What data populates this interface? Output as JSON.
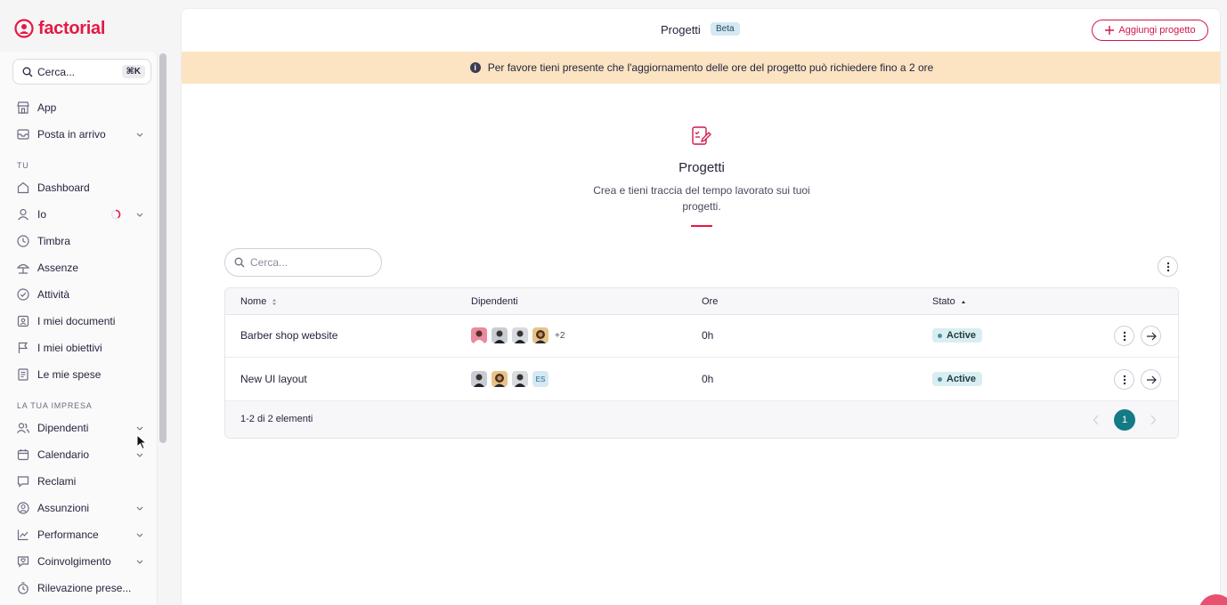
{
  "brand": {
    "name": "factorial",
    "color": "#e51943"
  },
  "sidebar": {
    "search": {
      "placeholder": "Cerca...",
      "shortcut": "⌘K"
    },
    "top_items": [
      {
        "label": "App",
        "icon": "shop-icon"
      },
      {
        "label": "Posta in arrivo",
        "icon": "inbox-icon",
        "has_chevron": true
      }
    ],
    "section_you": "TU",
    "you_items": [
      {
        "label": "Dashboard",
        "icon": "home-icon"
      },
      {
        "label": "Io",
        "icon": "person-icon",
        "has_chevron": true
      },
      {
        "label": "Timbra",
        "icon": "clock-icon"
      },
      {
        "label": "Assenze",
        "icon": "beach-icon"
      },
      {
        "label": "Attività",
        "icon": "check-circle-icon"
      },
      {
        "label": "I miei documenti",
        "icon": "folder-icon"
      },
      {
        "label": "I miei obiettivi",
        "icon": "flag-icon"
      },
      {
        "label": "Le mie spese",
        "icon": "receipt-icon"
      }
    ],
    "section_company": "LA TUA IMPRESA",
    "company_items": [
      {
        "label": "Dipendenti",
        "icon": "people-icon",
        "has_chevron": true
      },
      {
        "label": "Calendario",
        "icon": "calendar-icon",
        "has_chevron": true
      },
      {
        "label": "Reclami",
        "icon": "chat-icon"
      },
      {
        "label": "Assunzioni",
        "icon": "user-circle-icon",
        "has_chevron": true
      },
      {
        "label": "Performance",
        "icon": "chart-icon",
        "has_chevron": true
      },
      {
        "label": "Coinvolgimento",
        "icon": "heart-chat-icon",
        "has_chevron": true
      },
      {
        "label": "Rilevazione prese...",
        "icon": "stopwatch-icon"
      }
    ]
  },
  "header": {
    "title": "Progetti",
    "badge": "Beta",
    "add_button": "Aggiungi progetto"
  },
  "banner": {
    "text": "Per favore tieni presente che l'aggiornamento delle ore del progetto può richiedere fino a 2 ore"
  },
  "hero": {
    "title": "Progetti",
    "subtitle": "Crea e tieni traccia del tempo lavorato sui tuoi progetti."
  },
  "table": {
    "search_placeholder": "Cerca...",
    "columns": [
      "Nome",
      "Dipendenti",
      "Ore",
      "Stato"
    ],
    "rows": [
      {
        "name": "Barber shop website",
        "avatars_extra": "+2",
        "hours": "0h",
        "status": "Active"
      },
      {
        "name": "New UI layout",
        "avatars_extra": "ES",
        "hours": "0h",
        "status": "Active"
      }
    ],
    "footer": "1-2 di 2 elementi",
    "current_page": "1"
  },
  "colors": {
    "accent": "#e51943",
    "banner_bg": "#fce4c3",
    "status_bg": "#d9eef0",
    "pager_active": "#147b85"
  }
}
